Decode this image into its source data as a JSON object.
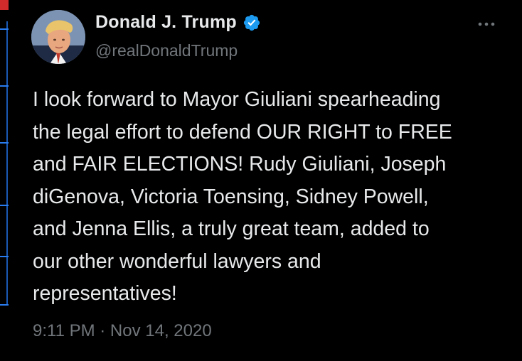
{
  "colors": {
    "background": "#000000",
    "text_primary": "#e7e9ea",
    "text_secondary": "#71767b",
    "verified_blue": "#1d9bf0"
  },
  "tweet": {
    "author": {
      "display_name": "Donald J. Trump",
      "handle": "@realDonaldTrump",
      "verified": true,
      "verified_icon": "verified-badge-icon",
      "avatar_icon": "profile-photo"
    },
    "more_icon": "more-options-icon",
    "text_lines": [
      "I look forward to Mayor Giuliani spearheading",
      "the legal effort to defend OUR RIGHT to FREE",
      "and FAIR ELECTIONS! Rudy Giuliani, Joseph",
      "diGenova, Victoria Toensing, Sidney Powell,",
      "and Jenna Ellis, a truly great team, added to",
      "our other wonderful lawyers and",
      "representatives!"
    ],
    "timestamp": "9:11 PM · Nov 14, 2020"
  }
}
